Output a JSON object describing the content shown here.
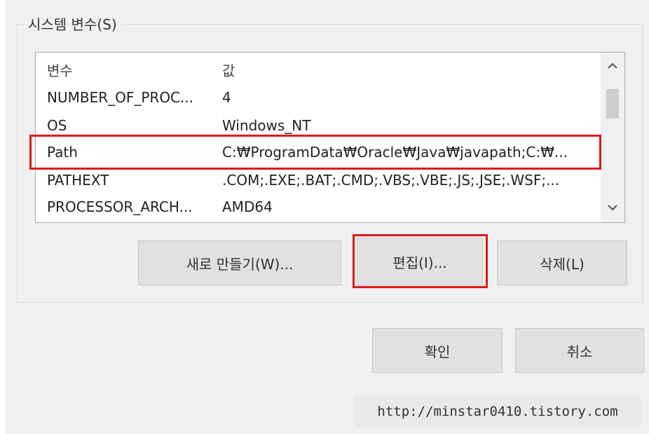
{
  "group": {
    "title": "시스템 변수(S)"
  },
  "list": {
    "headers": {
      "variable": "변수",
      "value": "값"
    },
    "rows": [
      {
        "variable": "NUMBER_OF_PROC...",
        "value": "4"
      },
      {
        "variable": "OS",
        "value": "Windows_NT"
      },
      {
        "variable": "Path",
        "value": "C:₩ProgramData₩Oracle₩Java₩javapath;C:₩..."
      },
      {
        "variable": "PATHEXT",
        "value": ".COM;.EXE;.BAT;.CMD;.VBS;.VBE;.JS;.JSE;.WSF;..."
      },
      {
        "variable": "PROCESSOR_ARCH...",
        "value": "AMD64"
      }
    ]
  },
  "buttons": {
    "new": "새로 만들기(W)...",
    "edit": "편집(I)...",
    "delete": "삭제(L)",
    "ok": "확인",
    "cancel": "취소"
  },
  "scrollbar": {
    "up_icon": "chevron-up-icon",
    "down_icon": "chevron-down-icon"
  },
  "highlight_color": "#e01818",
  "watermark": "http://minstar0410.tistory.com"
}
